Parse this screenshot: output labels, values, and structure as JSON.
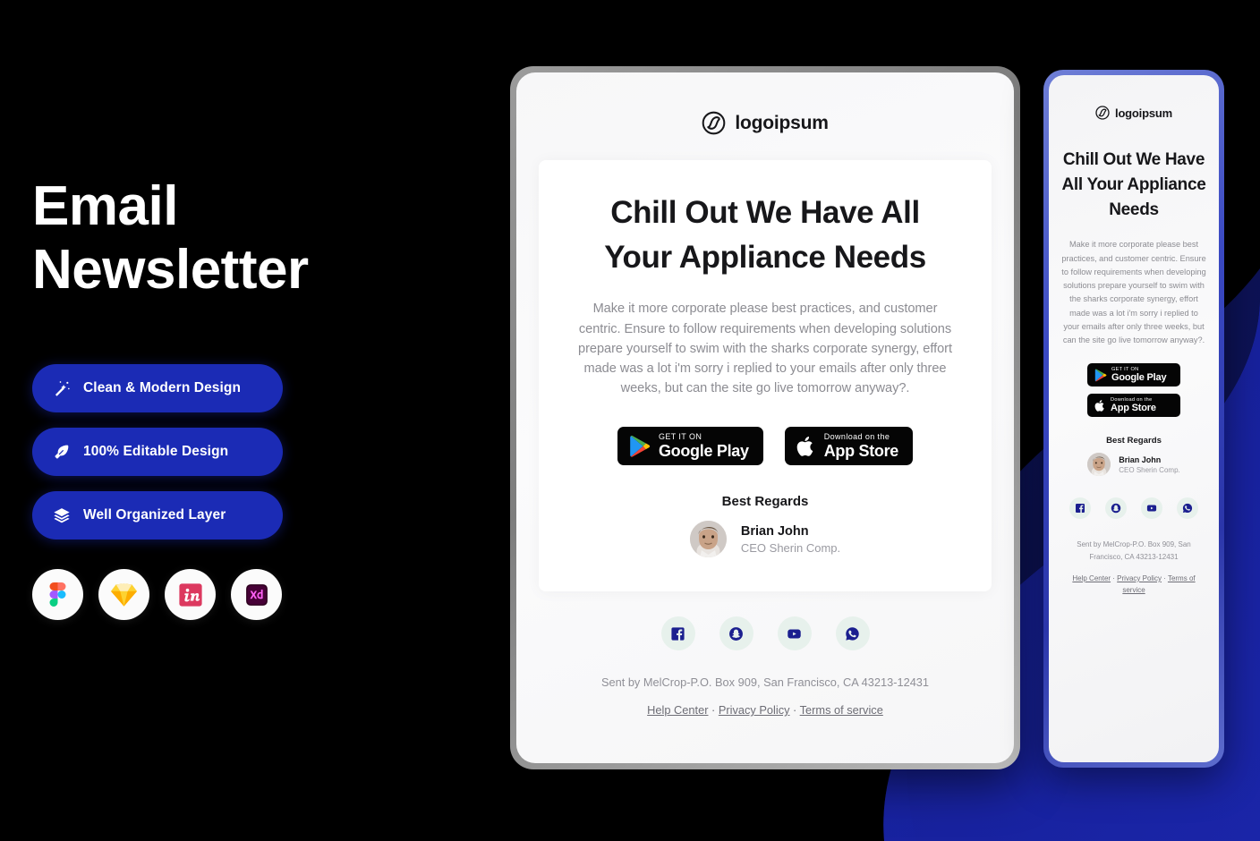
{
  "background": {
    "base_color": "#000000",
    "accent_color": "#141c8c",
    "accent_color_2": "#1d2ab0"
  },
  "left_panel": {
    "title_line1": "Email",
    "title_line2": "Newsletter",
    "features": [
      {
        "label": "Clean & Modern  Design",
        "icon": "magic-wand-icon"
      },
      {
        "label": "100% Editable Design",
        "icon": "pen-nib-icon"
      },
      {
        "label": "Well Organized Layer",
        "icon": "layers-icon"
      }
    ],
    "tools": [
      {
        "name": "figma-icon",
        "label": "Figma"
      },
      {
        "name": "sketch-icon",
        "label": "Sketch"
      },
      {
        "name": "invision-icon",
        "label": "InVision"
      },
      {
        "name": "adobe-xd-icon",
        "label": "Adobe XD"
      }
    ]
  },
  "email": {
    "brand": "logoipsum",
    "headline": "Chill Out We Have All Your Appliance Needs",
    "body": "Make it more corporate please best practices, and customer centric. Ensure to follow requirements when developing solutions prepare yourself to swim with the sharks corporate synergy, effort made was a lot i'm sorry i replied to your emails after only three weeks, but can the site go live tomorrow anyway?.",
    "store_badges": [
      {
        "small": "GET IT ON",
        "big": "Google Play",
        "icon": "google-play-icon"
      },
      {
        "small": "Download on the",
        "big": "App Store",
        "icon": "apple-icon"
      }
    ],
    "regards": "Best Regards",
    "signature_name": "Brian John",
    "signature_role": "CEO Sherin Comp.",
    "socials": [
      {
        "name": "facebook-icon",
        "label": "Facebook"
      },
      {
        "name": "snapchat-icon",
        "label": "Snapchat"
      },
      {
        "name": "youtube-icon",
        "label": "YouTube"
      },
      {
        "name": "whatsapp-icon",
        "label": "WhatsApp"
      }
    ],
    "footer_text": "Sent by MelCrop-P.O. Box 909, San Francisco, CA 43213-12431",
    "footer_links": [
      {
        "label": "Help Center"
      },
      {
        "label": "Privacy Policy"
      },
      {
        "label": "Terms of service"
      }
    ],
    "footer_separator": " · "
  }
}
